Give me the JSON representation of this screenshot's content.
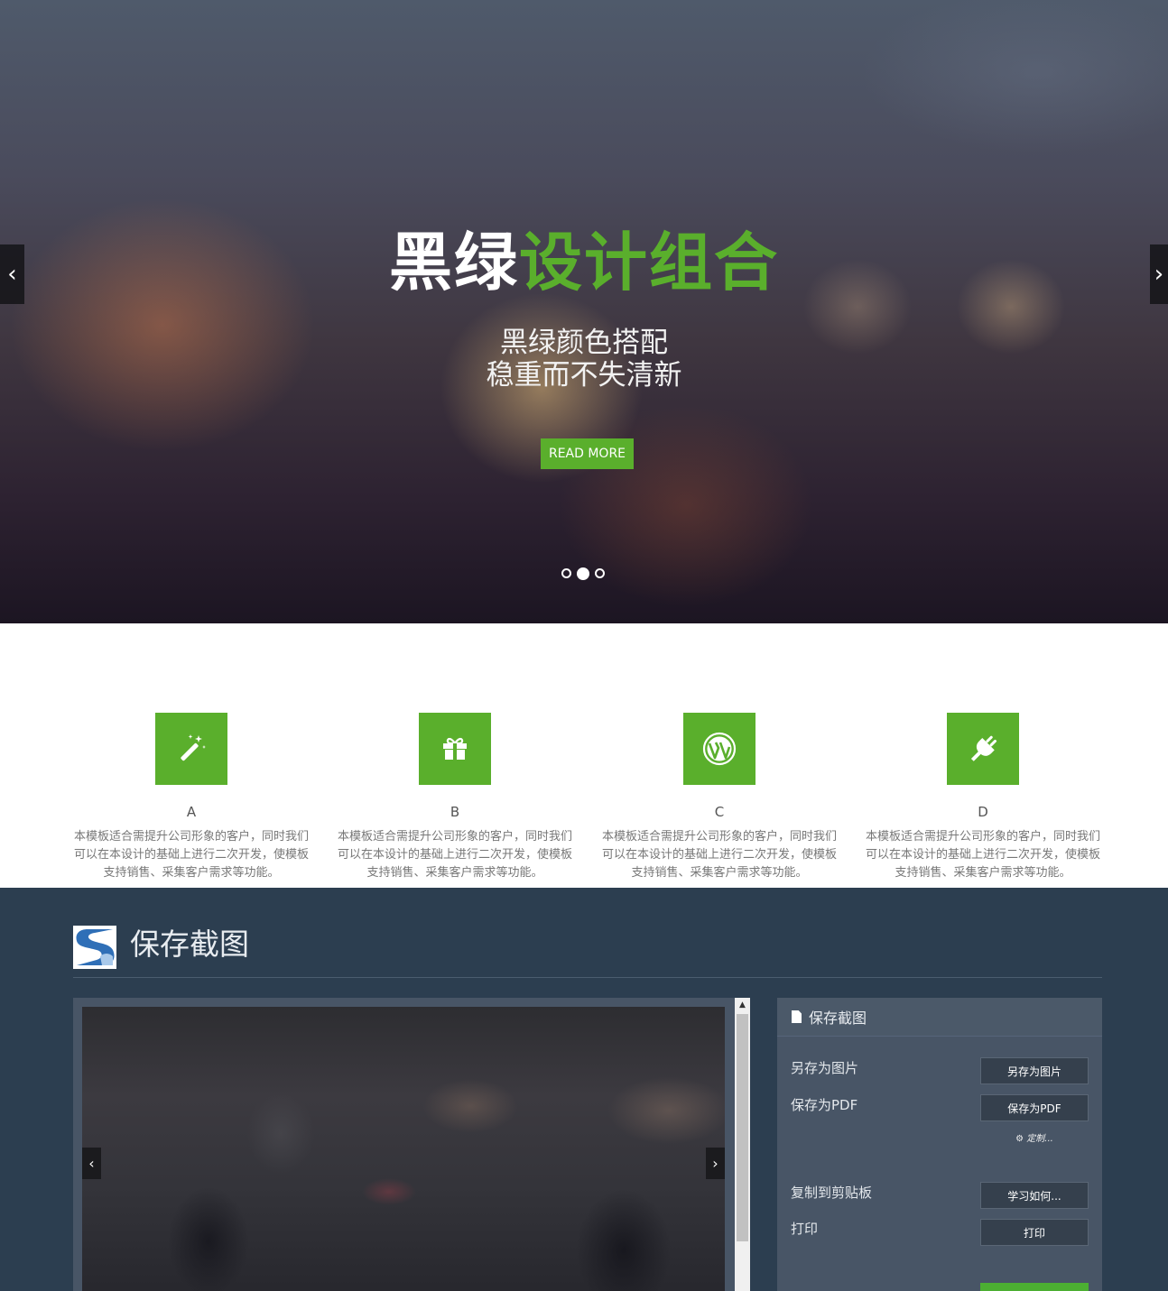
{
  "hero": {
    "title_white": "黑绿",
    "title_green": "设计组合",
    "subtitle_line1": "黑绿颜色搭配",
    "subtitle_line2": "稳重而不失清新",
    "button_label": "READ MORE",
    "prev_arrow": "‹",
    "next_arrow": "›",
    "active_dot": 2
  },
  "features": [
    {
      "icon": "magic-wand-icon",
      "name": "A",
      "description": "本模板适合需提升公司形象的客户，同时我们可以在本设计的基础上进行二次开发，使模板支持销售、采集客户需求等功能。"
    },
    {
      "icon": "gift-icon",
      "name": "B",
      "description": "本模板适合需提升公司形象的客户，同时我们可以在本设计的基础上进行二次开发，使模板支持销售、采集客户需求等功能。"
    },
    {
      "icon": "wordpress-icon",
      "name": "C",
      "description": "本模板适合需提升公司形象的客户，同时我们可以在本设计的基础上进行二次开发，使模板支持销售、采集客户需求等功能。"
    },
    {
      "icon": "plug-icon",
      "name": "D",
      "description": "本模板适合需提升公司形象的客户，同时我们可以在本设计的基础上进行二次开发，使模板支持销售、采集客户需求等功能。"
    }
  ],
  "screenshot_section": {
    "title": "保存截图",
    "logo_icon": "s-logo-icon",
    "preview_prev": "‹",
    "preview_next": "›",
    "panel": {
      "header": "保存截图",
      "save_image_label": "另存为图片",
      "save_image_button": "另存为图片",
      "save_pdf_label": "保存为PDF",
      "save_pdf_button": "保存为PDF",
      "customize_link": "定制...",
      "copy_label": "复制到剪贴板",
      "copy_button": "学习如何...",
      "print_label": "打印",
      "print_button": "打印"
    }
  },
  "colors": {
    "accent_green": "#5aaf2c",
    "dark_section": "#2c3e50",
    "panel": "#485566"
  }
}
